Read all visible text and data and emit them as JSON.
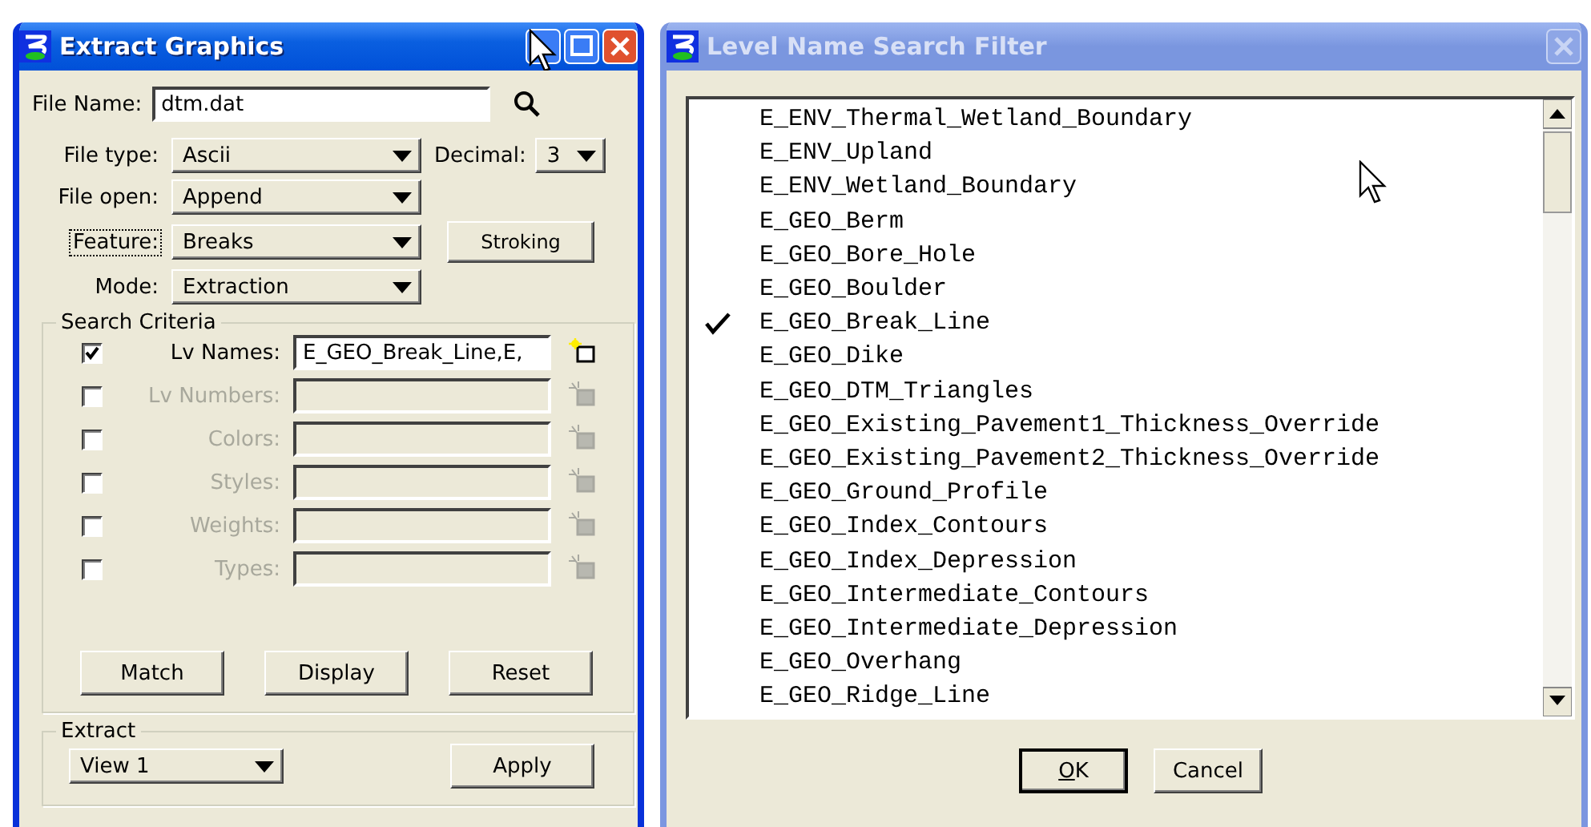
{
  "extract_window": {
    "title": "Extract Graphics",
    "active": true,
    "file_name": {
      "label": "File Name:",
      "value": "dtm.dat"
    },
    "options": [
      {
        "label": "File type:",
        "value": "Ascii",
        "focused": false
      },
      {
        "label": "File open:",
        "value": "Append",
        "focused": false
      },
      {
        "label": "Feature:",
        "value": "Breaks",
        "focused": true
      },
      {
        "label": "Mode:",
        "value": "Extraction",
        "focused": false
      }
    ],
    "decimal": {
      "label": "Decimal:",
      "value": "3"
    },
    "stroking_button": "Stroking",
    "search_criteria": {
      "title": "Search Criteria",
      "rows": [
        {
          "label": "Lv Names:",
          "value": "E_GEO_Break_Line,E,",
          "checked": true,
          "disabled": false
        },
        {
          "label": "Lv Numbers:",
          "checked": false,
          "disabled": true
        },
        {
          "label": "Colors:",
          "checked": false,
          "disabled": true
        },
        {
          "label": "Styles:",
          "checked": false,
          "disabled": true
        },
        {
          "label": "Weights:",
          "checked": false,
          "disabled": true
        },
        {
          "label": "Types:",
          "checked": false,
          "disabled": true
        }
      ],
      "buttons": [
        "Match",
        "Display",
        "Reset"
      ]
    },
    "extract": {
      "title": "Extract",
      "view": "View 1",
      "apply_button": "Apply"
    }
  },
  "filter_window": {
    "title": "Level Name Search Filter",
    "active": false,
    "items": [
      {
        "label": "E_ENV_Thermal_Wetland_Boundary",
        "checked": false
      },
      {
        "label": "E_ENV_Upland",
        "checked": false
      },
      {
        "label": "E_ENV_Wetland_Boundary",
        "checked": false
      },
      {
        "label": "E_GEO_Berm",
        "checked": false
      },
      {
        "label": "E_GEO_Bore_Hole",
        "checked": false
      },
      {
        "label": "E_GEO_Boulder",
        "checked": false
      },
      {
        "label": "E_GEO_Break_Line",
        "checked": true
      },
      {
        "label": "E_GEO_Dike",
        "checked": false
      },
      {
        "label": "E_GEO_DTM_Triangles",
        "checked": false
      },
      {
        "label": "E_GEO_Existing_Pavement1_Thickness_Override",
        "checked": false
      },
      {
        "label": "E_GEO_Existing_Pavement2_Thickness_Override",
        "checked": false
      },
      {
        "label": "E_GEO_Ground_Profile",
        "checked": false
      },
      {
        "label": "E_GEO_Index_Contours",
        "checked": false
      },
      {
        "label": "E_GEO_Index_Depression",
        "checked": false
      },
      {
        "label": "E_GEO_Intermediate_Contours",
        "checked": false
      },
      {
        "label": "E_GEO_Intermediate_Depression",
        "checked": false
      },
      {
        "label": "E_GEO_Overhang",
        "checked": false
      },
      {
        "label": "E_GEO_Ridge_Line",
        "checked": false
      }
    ],
    "buttons": [
      {
        "label": "OK",
        "default": true
      },
      {
        "label": "Cancel",
        "default": false
      }
    ]
  }
}
